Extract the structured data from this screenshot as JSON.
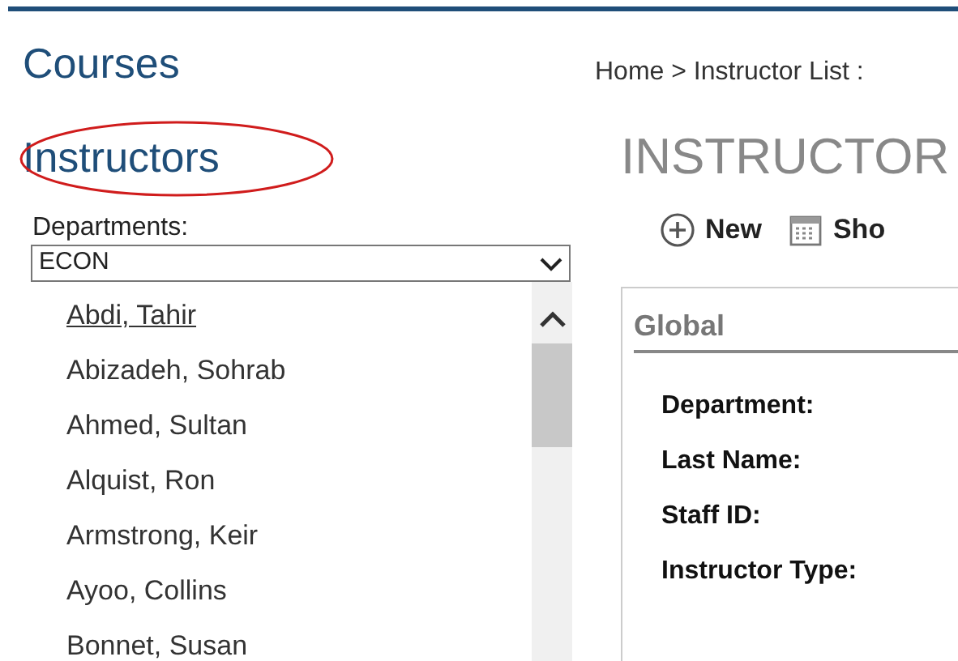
{
  "nav": {
    "links": [
      "Courses",
      "Instructors"
    ]
  },
  "departments": {
    "label": "Departments:",
    "value": "ECON"
  },
  "instructors": [
    {
      "name": "Abdi, Tahir",
      "selected": true
    },
    {
      "name": "Abizadeh, Sohrab",
      "selected": false
    },
    {
      "name": "Ahmed, Sultan",
      "selected": false
    },
    {
      "name": "Alquist, Ron",
      "selected": false
    },
    {
      "name": "Armstrong, Keir",
      "selected": false
    },
    {
      "name": "Ayoo, Collins",
      "selected": false
    },
    {
      "name": "Bonnet, Susan",
      "selected": false
    }
  ],
  "breadcrumb": "Home > Instructor List :",
  "page_title": "INSTRUCTOR",
  "toolbar": [
    {
      "kind": "new",
      "label": "New"
    },
    {
      "kind": "show",
      "label": "Sho"
    }
  ],
  "panel": {
    "title": "Global",
    "fields": [
      "Department:",
      "Last Name:",
      "Staff ID:",
      "Instructor Type:"
    ]
  }
}
